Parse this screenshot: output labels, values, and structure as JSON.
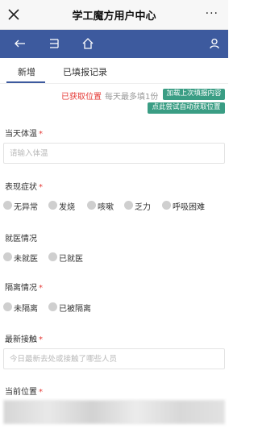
{
  "header": {
    "title": "学工魔方用户中心",
    "more": "···"
  },
  "tabs": [
    {
      "label": "新增",
      "active": true
    },
    {
      "label": "已填报记录",
      "active": false
    }
  ],
  "location": {
    "status": "已获取位置",
    "note": "每天最多填1份",
    "load_button": "加载上次填报内容",
    "auto_button": "点此尝试自动获取位置"
  },
  "form": {
    "temperature": {
      "label": "当天体温",
      "required": "*",
      "placeholder": "请输入体温"
    },
    "symptoms": {
      "label": "表现症状",
      "required": "*",
      "options": [
        "无异常",
        "发烧",
        "咳嗽",
        "乏力",
        "呼吸困难"
      ]
    },
    "medical": {
      "label": "就医情况",
      "options": [
        "未就医",
        "已就医"
      ]
    },
    "isolation": {
      "label": "隔离情况",
      "required": "*",
      "options": [
        "未隔离",
        "已被隔离"
      ]
    },
    "contact": {
      "label": "最新接触",
      "required": "*",
      "placeholder": "今日最新去处或接触了哪些人员"
    },
    "position": {
      "label": "当前位置",
      "required": "*"
    }
  },
  "colors": {
    "navbar": "#3d5a9e",
    "accent_button": "#3a9d84",
    "required": "#e53935"
  },
  "icons": {
    "close": "close-icon",
    "back": "arrow-left-icon",
    "menu": "menu-icon",
    "home": "home-icon",
    "user": "user-icon"
  }
}
